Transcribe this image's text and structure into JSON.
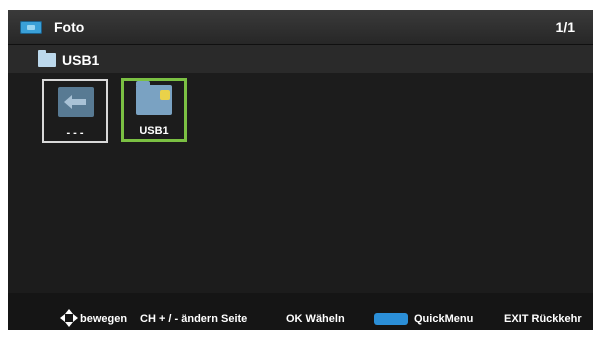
{
  "header": {
    "title": "Foto",
    "page_indicator": "1/1",
    "icon": "photo-folder-icon"
  },
  "path": {
    "label": "USB1",
    "icon": "folder-icon"
  },
  "items": [
    {
      "label": "- - -",
      "icon": "back-arrow-icon",
      "selected": false
    },
    {
      "label": "USB1",
      "icon": "usb-folder-icon",
      "selected": true
    }
  ],
  "footer": {
    "nav_label": "bewegen",
    "page_label": "CH + / -  ändern Seite",
    "ok_label": "OK  Wäheln",
    "quick_menu_label": "QuickMenu",
    "exit_label": "EXIT  Rückkehr"
  },
  "colors": {
    "selection": "#7bc043",
    "quick_menu": "#2b8fd8"
  }
}
